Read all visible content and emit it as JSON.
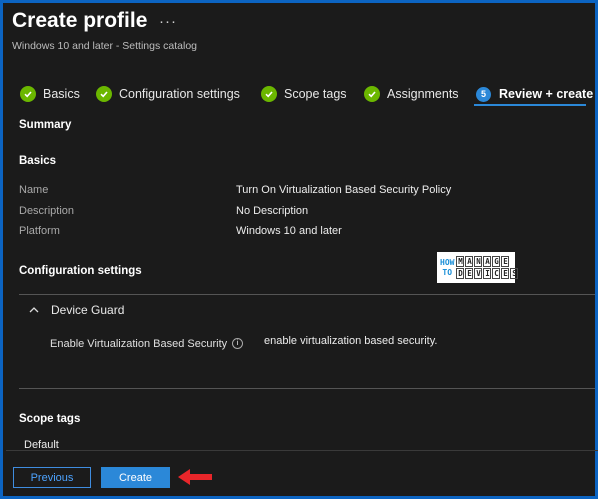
{
  "header": {
    "title": "Create profile",
    "more": "···",
    "subtitle": "Windows 10 and later - Settings catalog"
  },
  "steps": [
    {
      "label": "Basics",
      "state": "done"
    },
    {
      "label": "Configuration settings",
      "state": "done"
    },
    {
      "label": "Scope tags",
      "state": "done"
    },
    {
      "label": "Assignments",
      "state": "done"
    },
    {
      "label": "Review + create",
      "state": "active",
      "number": "5"
    }
  ],
  "summary": {
    "heading": "Summary",
    "basics": {
      "heading": "Basics",
      "rows": [
        {
          "label": "Name",
          "value": "Turn On Virtualization Based Security Policy"
        },
        {
          "label": "Description",
          "value": "No Description"
        },
        {
          "label": "Platform",
          "value": "Windows 10 and later"
        }
      ]
    },
    "config": {
      "heading": "Configuration settings",
      "group": "Device Guard",
      "setting_label": "Enable Virtualization Based Security",
      "setting_value": "enable virtualization based security."
    },
    "scope": {
      "heading": "Scope tags",
      "value": "Default"
    }
  },
  "watermark": {
    "how": "HOW",
    "to": "TO",
    "row1": [
      "M",
      "A",
      "N",
      "A",
      "G",
      "E"
    ],
    "row2": [
      "D",
      "E",
      "V",
      "I",
      "C",
      "E",
      "S"
    ]
  },
  "footer": {
    "previous": "Previous",
    "create": "Create"
  },
  "colors": {
    "check": "#6bb700",
    "accent": "#2b88d8",
    "border": "#0c64c2",
    "arrow": "#e8262a"
  },
  "icons": {
    "step_done": "checkmark-circle-icon",
    "step_active": "number-circle-icon",
    "collapse": "chevron-up-icon",
    "info": "info-icon",
    "annotation": "red-arrow-icon"
  }
}
